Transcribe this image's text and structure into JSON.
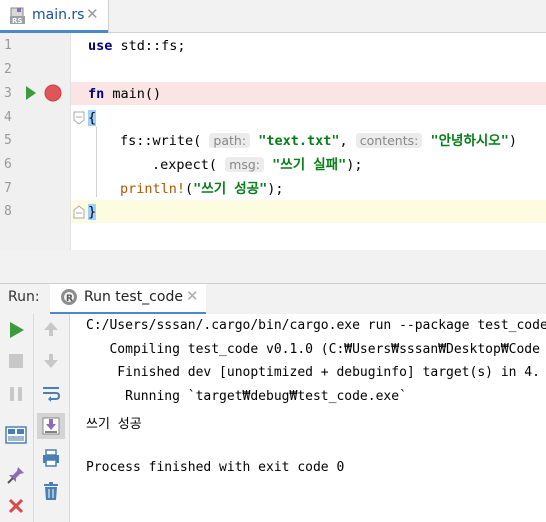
{
  "editor_tab": {
    "filename": "main.rs",
    "close_glyph": "✕",
    "icon": "rust-file-icon"
  },
  "line_numbers": [
    "1",
    "2",
    "3",
    "4",
    "5",
    "6",
    "7",
    "8"
  ],
  "code": {
    "line1": {
      "kw": "use",
      "rest": " std::fs;"
    },
    "line3": {
      "kw": "fn",
      "rest": " main()"
    },
    "line4": {
      "brace": "{"
    },
    "line5": {
      "pre": "fs::write(",
      "hint1": "path:",
      "str1": "\"text.txt\"",
      "sep": ",",
      "hint2": "contents:",
      "str2": "\"안녕하시오\"",
      "post": ")"
    },
    "line6": {
      "pre": ".expect(",
      "hint": "msg:",
      "str": "\"쓰기 실패\"",
      "post": ");"
    },
    "line7": {
      "macro": "println!",
      "open": "(",
      "str": "\"쓰기 성공\"",
      "post": ");"
    },
    "line8": {
      "brace": "}"
    }
  },
  "run_window": {
    "label": "Run:",
    "tab_label": "Run test_code",
    "tab_close": "✕",
    "console_lines": [
      "C:/Users/sssan/.cargo/bin/cargo.exe run --package test_code",
      "   Compiling test_code v0.1.0 (C:₩Users₩sssan₩Desktop₩Code",
      "    Finished dev [unoptimized + debuginfo] target(s) in 4.",
      "     Running `target₩debug₩test_code.exe`",
      "쓰기 성공",
      "",
      "Process finished with exit code 0"
    ]
  },
  "colors": {
    "accent": "#4a88c7",
    "run_green": "#3d9b3d",
    "breakpoint_red": "#e05555",
    "string_green": "#067d17",
    "keyword_navy": "#000080",
    "macro_orange": "#b05800"
  }
}
